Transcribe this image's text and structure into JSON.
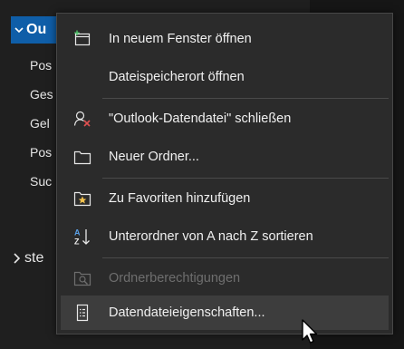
{
  "folder_pane": {
    "account_name": "Ou",
    "folders": [
      "Pos",
      "Ges",
      "Gel",
      "Pos",
      "Suc"
    ],
    "second_account": "ste"
  },
  "context_menu": {
    "items": [
      {
        "label": "In neuem Fenster öffnen",
        "icon": "new-window-icon",
        "enabled": true
      },
      {
        "label": "Dateispeicherort öffnen",
        "icon": "",
        "enabled": true
      },
      {
        "label": "\"Outlook-Datendatei\" schließen",
        "icon": "close-datafile-icon",
        "enabled": true
      },
      {
        "label": "Neuer Ordner...",
        "icon": "folder-icon",
        "enabled": true
      },
      {
        "label": "Zu Favoriten hinzufügen",
        "icon": "favorite-star-icon",
        "enabled": true
      },
      {
        "label": "Unterordner von A nach Z sortieren",
        "icon": "sort-az-icon",
        "enabled": true
      },
      {
        "label": "Ordnerberechtigungen",
        "icon": "folder-permissions-icon",
        "enabled": false
      },
      {
        "label": "Datendateieigenschaften...",
        "icon": "properties-icon",
        "enabled": true
      }
    ]
  },
  "colors": {
    "accent": "#0f5ea8",
    "menu_bg": "#2b2b2b",
    "hover_bg": "#3d3d3d",
    "text": "#f0f0f0",
    "disabled_text": "#6e6e6e",
    "close_red": "#e05050",
    "star_yellow": "#f2c14e"
  }
}
